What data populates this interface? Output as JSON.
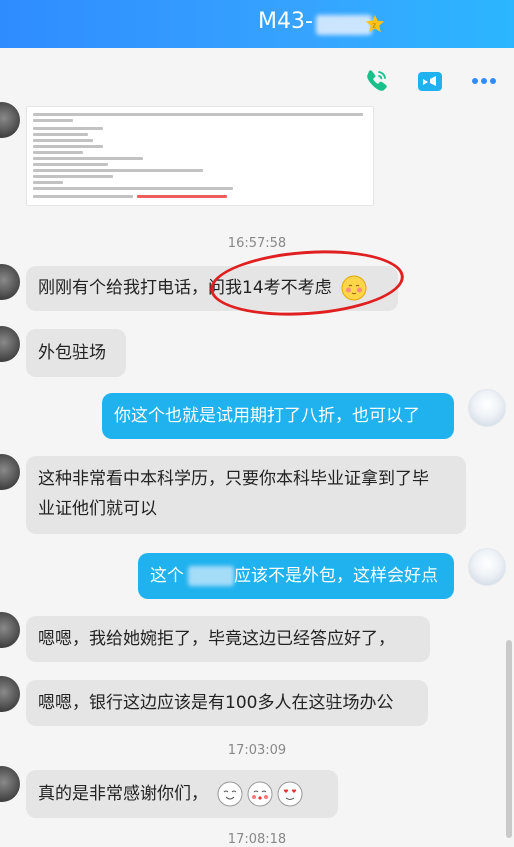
{
  "header": {
    "title": "M43-",
    "title_blurred": true,
    "badge": "vip-star-icon",
    "bg_color": "#2f8cff"
  },
  "toolbar": {
    "icons": [
      "phone-icon",
      "video-call-icon",
      "more-icon"
    ],
    "accent": "#18c08a"
  },
  "messages": [
    {
      "type": "time",
      "text": "16:57:58"
    },
    {
      "type": "in",
      "text": "刚刚有个给我打电话，问我14考不考虑",
      "emoji": "blush-emoji"
    },
    {
      "type": "in",
      "text": "外包驻场"
    },
    {
      "type": "out",
      "text": "你这个也就是试用期打了八折，也可以了"
    },
    {
      "type": "in",
      "lines": [
        "这种非常看中本科学历，只要你本科毕业证拿到了毕",
        "业证他们就可以"
      ]
    },
    {
      "type": "out",
      "parts": [
        "这个",
        "应该不是外包，这样会好点"
      ],
      "redacted": true
    },
    {
      "type": "in",
      "text": "嗯嗯，我给她婉拒了，毕竟这边已经答应好了，"
    },
    {
      "type": "in",
      "text": "嗯嗯，银行这边应该是有100多人在这驻场办公"
    },
    {
      "type": "time",
      "text": "17:03:09"
    },
    {
      "type": "in",
      "text": "真的是非常感谢你们，",
      "emojis": [
        "smile-emoji",
        "kiss-emoji",
        "heart-eyes-emoji"
      ]
    },
    {
      "type": "time",
      "text": "17:08:18"
    }
  ]
}
